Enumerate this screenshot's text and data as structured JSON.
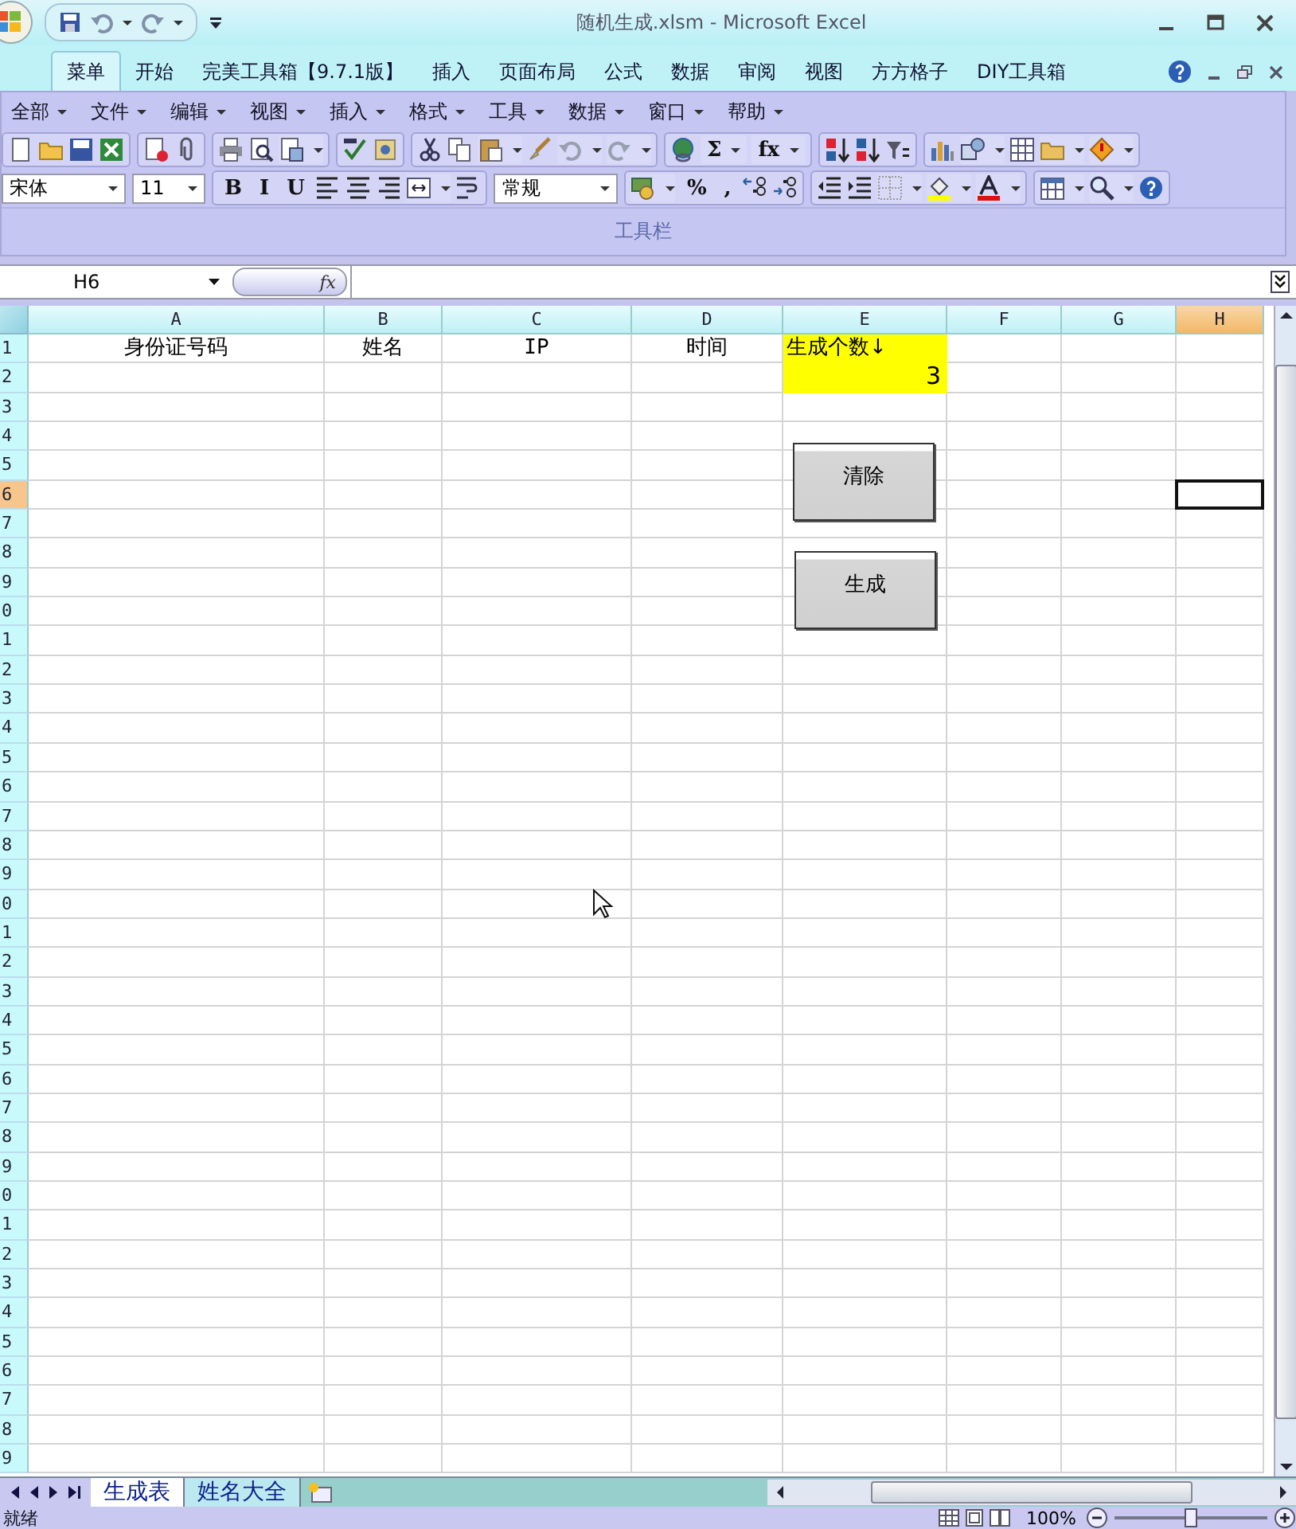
{
  "window": {
    "title": "随机生成.xlsm - Microsoft Excel"
  },
  "ribbon_tabs": [
    {
      "label": "菜单",
      "selected": true
    },
    {
      "label": "开始",
      "selected": false
    },
    {
      "label": "完美工具箱【9.7.1版】",
      "selected": false
    },
    {
      "label": "插入",
      "selected": false
    },
    {
      "label": "页面布局",
      "selected": false
    },
    {
      "label": "公式",
      "selected": false
    },
    {
      "label": "数据",
      "selected": false
    },
    {
      "label": "审阅",
      "selected": false
    },
    {
      "label": "视图",
      "selected": false
    },
    {
      "label": "方方格子",
      "selected": false
    },
    {
      "label": "DIY工具箱",
      "selected": false
    }
  ],
  "menus": [
    "全部",
    "文件",
    "编辑",
    "视图",
    "插入",
    "格式",
    "工具",
    "数据",
    "窗口",
    "帮助"
  ],
  "toolbar_1": [
    {
      "kind": "icon",
      "dropdown": false
    },
    {
      "kind": "icon",
      "dropdown": false
    },
    {
      "kind": "icon",
      "dropdown": false
    },
    {
      "kind": "icon",
      "dropdown": false
    },
    {
      "kind": "sep"
    },
    {
      "kind": "icon",
      "dropdown": false
    },
    {
      "kind": "icon",
      "dropdown": false
    },
    {
      "kind": "sep"
    },
    {
      "kind": "icon",
      "dropdown": false
    },
    {
      "kind": "icon",
      "dropdown": false
    },
    {
      "kind": "icon",
      "dropdown": true
    },
    {
      "kind": "sep"
    },
    {
      "kind": "icon",
      "dropdown": false
    },
    {
      "kind": "icon",
      "dropdown": false
    },
    {
      "kind": "sep"
    },
    {
      "kind": "icon",
      "dropdown": false
    },
    {
      "kind": "icon",
      "dropdown": false
    },
    {
      "kind": "icon",
      "dropdown": true
    },
    {
      "kind": "icon",
      "dropdown": false
    },
    {
      "kind": "icon",
      "dropdown": true
    },
    {
      "kind": "icon",
      "dropdown": true
    },
    {
      "kind": "sep"
    },
    {
      "kind": "icon",
      "dropdown": false
    },
    {
      "kind": "text",
      "label": "Σ",
      "dropdown": true
    },
    {
      "kind": "text",
      "label": "fx",
      "dropdown": true
    },
    {
      "kind": "sep"
    },
    {
      "kind": "icon",
      "dropdown": false
    },
    {
      "kind": "icon",
      "dropdown": false
    },
    {
      "kind": "icon",
      "dropdown": false
    },
    {
      "kind": "sep"
    },
    {
      "kind": "icon",
      "dropdown": false
    },
    {
      "kind": "icon",
      "dropdown": true
    },
    {
      "kind": "icon",
      "dropdown": false
    },
    {
      "kind": "icon",
      "dropdown": true
    },
    {
      "kind": "icon",
      "dropdown": true
    }
  ],
  "toolbar_2": [
    {
      "kind": "field",
      "value": "宋体"
    },
    {
      "kind": "field",
      "value": "11"
    },
    {
      "kind": "sep"
    },
    {
      "kind": "text",
      "label": "B",
      "dropdown": false
    },
    {
      "kind": "text",
      "label": "I",
      "dropdown": false
    },
    {
      "kind": "text",
      "label": "U",
      "dropdown": false
    },
    {
      "kind": "icon",
      "dropdown": false
    },
    {
      "kind": "icon",
      "dropdown": false
    },
    {
      "kind": "icon",
      "dropdown": false
    },
    {
      "kind": "icon",
      "dropdown": true
    },
    {
      "kind": "icon",
      "dropdown": false
    },
    {
      "kind": "sep"
    },
    {
      "kind": "field",
      "value": "常规"
    },
    {
      "kind": "sep"
    },
    {
      "kind": "icon",
      "dropdown": true
    },
    {
      "kind": "text",
      "label": "%",
      "dropdown": false
    },
    {
      "kind": "text",
      "label": ",",
      "dropdown": false
    },
    {
      "kind": "icon",
      "dropdown": false
    },
    {
      "kind": "icon",
      "dropdown": false
    },
    {
      "kind": "sep"
    },
    {
      "kind": "icon",
      "dropdown": false
    },
    {
      "kind": "icon",
      "dropdown": false
    },
    {
      "kind": "icon",
      "dropdown": true
    },
    {
      "kind": "icon",
      "dropdown": true
    },
    {
      "kind": "icon",
      "dropdown": true
    },
    {
      "kind": "sep"
    },
    {
      "kind": "icon",
      "dropdown": true
    },
    {
      "kind": "icon",
      "dropdown": true
    },
    {
      "kind": "icon",
      "dropdown": false
    }
  ],
  "group_label": "工具栏",
  "formula_bar": {
    "name_box": "H6",
    "fx": "fx"
  },
  "sheet": {
    "columns": [
      {
        "label": "A",
        "selected": false
      },
      {
        "label": "B",
        "selected": false
      },
      {
        "label": "C",
        "selected": false
      },
      {
        "label": "D",
        "selected": false
      },
      {
        "label": "E",
        "selected": false
      },
      {
        "label": "F",
        "selected": false
      },
      {
        "label": "G",
        "selected": false
      },
      {
        "label": "H",
        "selected": true
      }
    ],
    "rows": [
      {
        "label": "1",
        "selected": false,
        "cells": {
          "A": {
            "text": "身份证号码",
            "kind": "header",
            "highlighted": false
          },
          "B": {
            "text": "姓名",
            "kind": "header",
            "highlighted": false
          },
          "C": {
            "text": "IP",
            "kind": "header",
            "highlighted": false
          },
          "D": {
            "text": "时间",
            "kind": "header",
            "highlighted": false
          },
          "E": {
            "text": "生成个数↓",
            "kind": "label",
            "highlighted": true
          }
        }
      },
      {
        "label": "2",
        "selected": false,
        "cells": {
          "E": {
            "text": "3",
            "kind": "number",
            "highlighted": true
          }
        }
      },
      {
        "label": "3",
        "selected": false
      },
      {
        "label": "4",
        "selected": false
      },
      {
        "label": "5",
        "selected": false
      },
      {
        "label": "6",
        "selected": true
      },
      {
        "label": "7",
        "selected": false
      },
      {
        "label": "8",
        "selected": false
      },
      {
        "label": "9",
        "selected": false
      },
      {
        "label": "0",
        "selected": false
      },
      {
        "label": "1",
        "selected": false
      },
      {
        "label": "2",
        "selected": false
      },
      {
        "label": "3",
        "selected": false
      },
      {
        "label": "4",
        "selected": false
      },
      {
        "label": "5",
        "selected": false
      },
      {
        "label": "6",
        "selected": false
      },
      {
        "label": "7",
        "selected": false
      },
      {
        "label": "8",
        "selected": false
      },
      {
        "label": "9",
        "selected": false
      },
      {
        "label": "0",
        "selected": false
      },
      {
        "label": "1",
        "selected": false
      },
      {
        "label": "2",
        "selected": false
      },
      {
        "label": "3",
        "selected": false
      },
      {
        "label": "4",
        "selected": false
      },
      {
        "label": "5",
        "selected": false
      },
      {
        "label": "6",
        "selected": false
      },
      {
        "label": "7",
        "selected": false
      },
      {
        "label": "8",
        "selected": false
      },
      {
        "label": "9",
        "selected": false
      },
      {
        "label": "0",
        "selected": false
      },
      {
        "label": "1",
        "selected": false
      },
      {
        "label": "2",
        "selected": false
      },
      {
        "label": "3",
        "selected": false
      },
      {
        "label": "4",
        "selected": false
      },
      {
        "label": "5",
        "selected": false
      },
      {
        "label": "6",
        "selected": false
      },
      {
        "label": "7",
        "selected": false
      },
      {
        "label": "8",
        "selected": false
      },
      {
        "label": "9",
        "selected": false
      }
    ],
    "buttons": [
      "清除",
      "生成"
    ]
  },
  "sheet_tabs": [
    {
      "label": "生成表",
      "selected": true
    },
    {
      "label": "姓名大全",
      "selected": false
    }
  ],
  "status_bar": {
    "text": "就绪",
    "zoom": "100%",
    "zoom_slider": {
      "level": 0.5
    }
  }
}
